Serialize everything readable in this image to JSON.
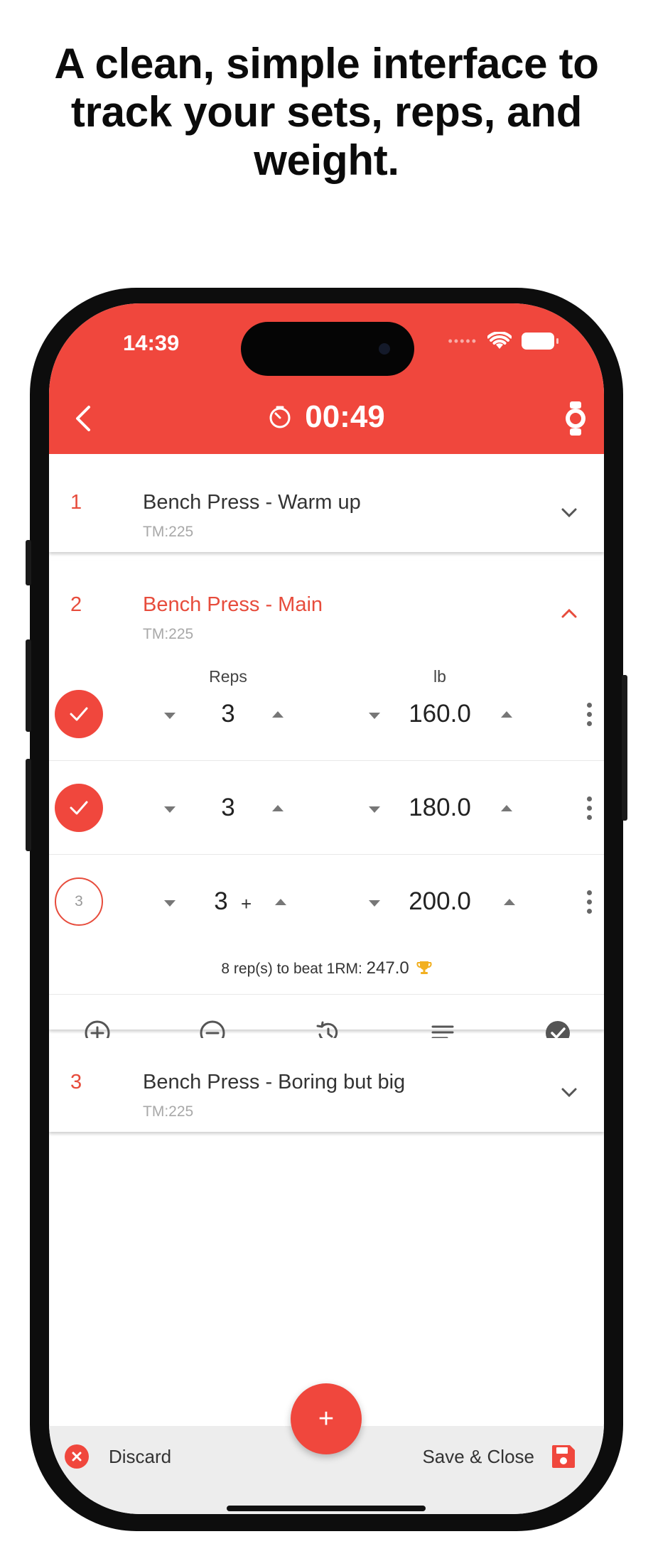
{
  "headline": "A clean, simple interface to track your sets, reps, and weight.",
  "status_bar": {
    "time": "14:39",
    "dots": "•••••"
  },
  "header": {
    "timer": "00:49",
    "accent_color": "#f0473d"
  },
  "exercises": [
    {
      "num": "1",
      "title": "Bench Press - Warm up",
      "tm": "TM:225"
    },
    {
      "num": "2",
      "title": "Bench Press - Main",
      "tm": "TM:225"
    },
    {
      "num": "3",
      "title": "Bench Press - Boring but big",
      "tm": "TM:225"
    }
  ],
  "columns": {
    "reps": "Reps",
    "weight": "lb"
  },
  "sets": [
    {
      "reps": "3",
      "weight": "160.0",
      "done": true
    },
    {
      "reps": "3",
      "weight": "180.0",
      "done": true
    },
    {
      "label": "3",
      "reps": "3",
      "amrap": "+",
      "weight": "200.0",
      "done": false
    }
  ],
  "beat": {
    "text": "8 rep(s) to beat 1RM:",
    "value": "247.0"
  },
  "actions": [
    "add-circle-icon",
    "remove-circle-icon",
    "history-icon",
    "notes-icon",
    "check-circle-icon"
  ],
  "bottom": {
    "discard": "Discard",
    "save": "Save & Close",
    "fab": "+"
  }
}
